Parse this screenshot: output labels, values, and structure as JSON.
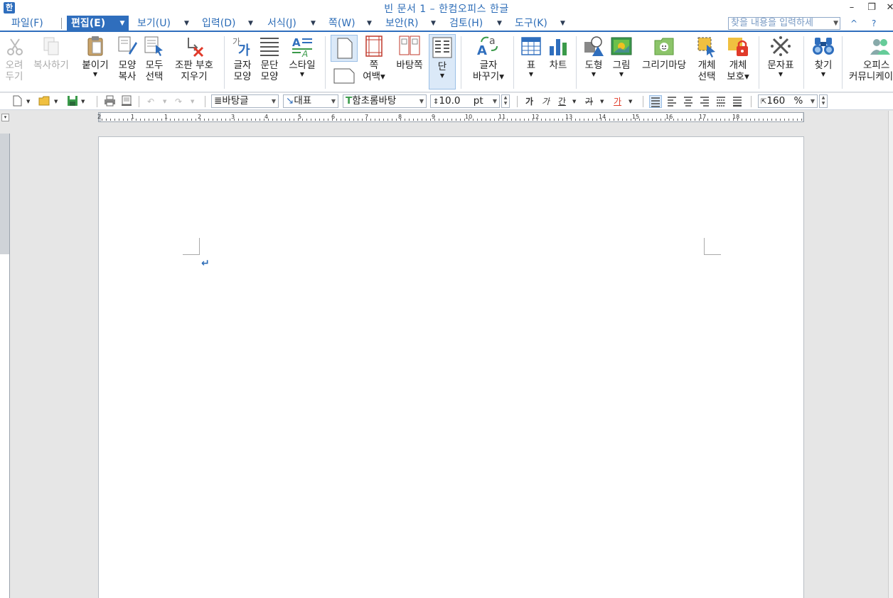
{
  "window": {
    "title": "빈 문서 1 – 한컴오피스 한글",
    "app_icon_label": "한",
    "minimize_label": "–",
    "restore_label": "❐",
    "close_label": "✕"
  },
  "menu": {
    "items": [
      {
        "label": "파일(F)"
      },
      {
        "label": "편집(E)",
        "active": true
      },
      {
        "label": "보기(U)"
      },
      {
        "label": "입력(D)"
      },
      {
        "label": "서식(J)"
      },
      {
        "label": "쪽(W)"
      },
      {
        "label": "보안(R)"
      },
      {
        "label": "검토(H)"
      },
      {
        "label": "도구(K)"
      }
    ],
    "search_placeholder": "찾을 내용을 입력하세",
    "help_label": "?",
    "collapse_label": "^"
  },
  "ribbon": {
    "cut": {
      "line1": "오려",
      "line2": "두기"
    },
    "copy": {
      "line1": "복사하기"
    },
    "paste": {
      "line1": "붙이기"
    },
    "format_copy": {
      "line1": "모양",
      "line2": "복사"
    },
    "select_all": {
      "line1": "모두",
      "line2": "선택"
    },
    "clear_marks": {
      "line1": "조판 부호",
      "line2": "지우기"
    },
    "char_shape": {
      "line1": "글자",
      "line2": "모양"
    },
    "para_shape": {
      "line1": "문단",
      "line2": "모양"
    },
    "style": {
      "line1": "스타일"
    },
    "page_margin": {
      "line1": "쪽",
      "line2": "여백"
    },
    "background_page": {
      "line1": "바탕쪽"
    },
    "columns": {
      "line1": "단"
    },
    "replace": {
      "line1": "글자",
      "line2": "바꾸기"
    },
    "table": {
      "line1": "표"
    },
    "chart": {
      "line1": "차트"
    },
    "shape": {
      "line1": "도형"
    },
    "picture": {
      "line1": "그림"
    },
    "drawing": {
      "line1": "그리기마당"
    },
    "object_select": {
      "line1": "개체",
      "line2": "선택"
    },
    "object_protect": {
      "line1": "개체",
      "line2": "보호"
    },
    "symbols": {
      "line1": "문자표"
    },
    "find": {
      "line1": "찾기"
    },
    "community": {
      "line1": "오피스",
      "line2": "커뮤니케이"
    }
  },
  "format_toolbar": {
    "style_value": "바탕글",
    "lang_value": "대표",
    "font_value": "함초롬바탕",
    "size_value": "10.0",
    "size_unit": "pt",
    "zoom_value": "160",
    "zoom_unit": "%",
    "bold_label": "가",
    "italic_label": "가",
    "underline_label": "간",
    "strike_label": "가",
    "color_label": "가"
  },
  "ruler": {
    "h_numbers": [
      "2",
      "1",
      "1",
      "2",
      "3",
      "4",
      "5",
      "6",
      "7",
      "8",
      "9",
      "10",
      "11",
      "12",
      "13",
      "14",
      "15",
      "16",
      "17",
      "18"
    ]
  },
  "document": {
    "para_mark": "↵"
  }
}
